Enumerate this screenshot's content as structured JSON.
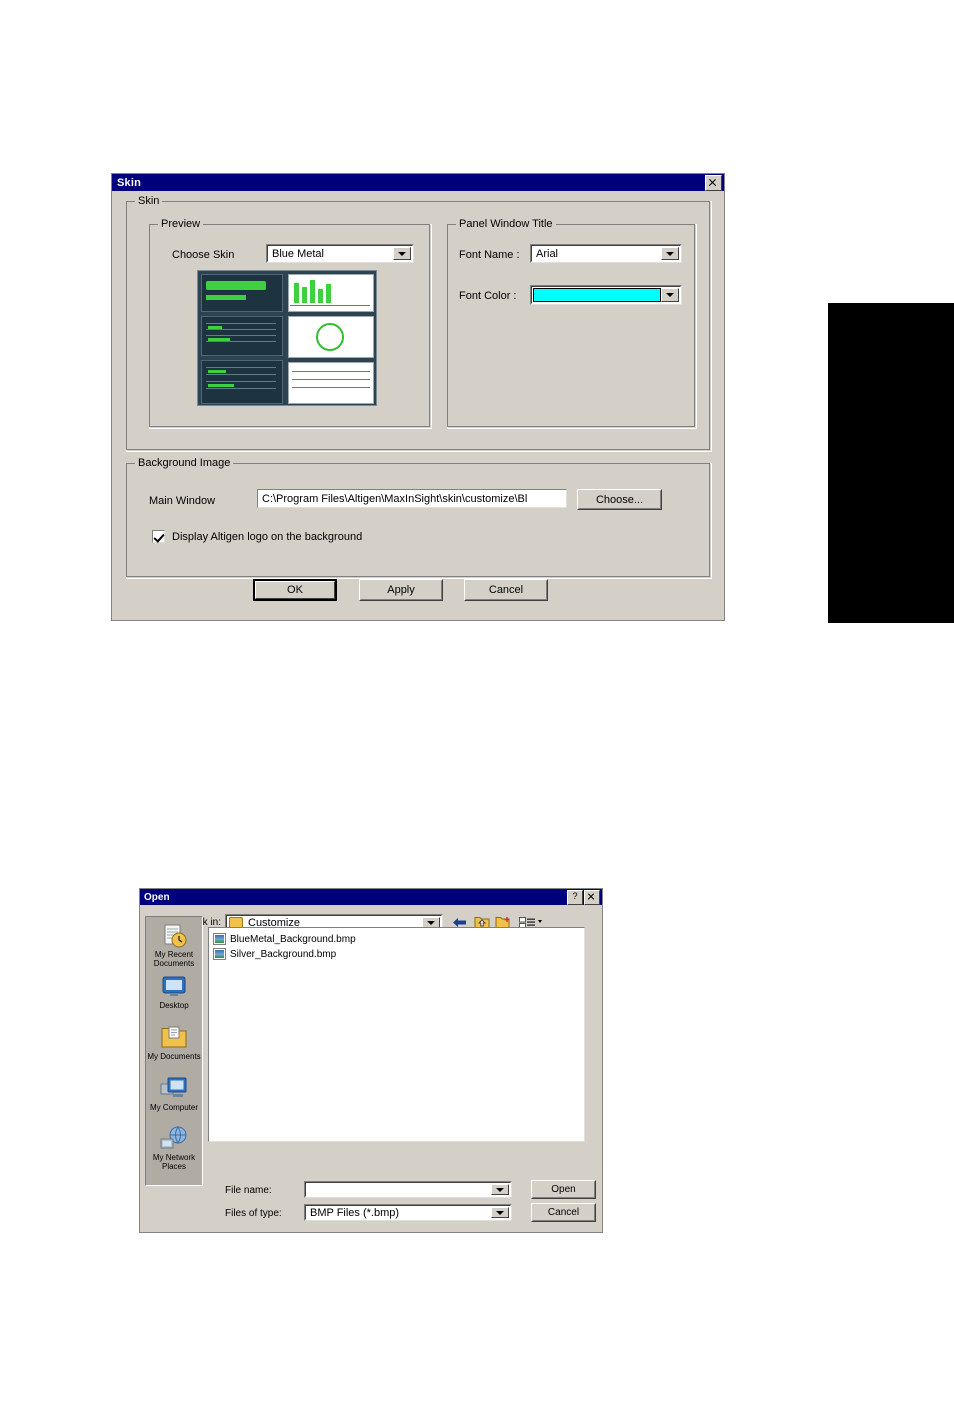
{
  "skin_dialog": {
    "title": "Skin",
    "close_label": "×",
    "groups": {
      "skin": "Skin",
      "preview": "Preview",
      "panel_window_title": "Panel Window Title",
      "background_image": "Background Image"
    },
    "choose_skin_label": "Choose Skin",
    "choose_skin_value": "Blue Metal",
    "font_name_label": "Font Name :",
    "font_name_value": "Arial",
    "font_color_label": "Font Color :",
    "font_color_value": "#00FFFF",
    "main_window_label": "Main Window",
    "main_window_path": "C:\\Program Files\\Altigen\\MaxInSight\\skin\\customize\\Bl",
    "choose_button": "Choose...",
    "display_logo_label": "Display Altigen logo on the background",
    "display_logo_checked": true,
    "ok_button": "OK",
    "apply_button": "Apply",
    "cancel_button": "Cancel"
  },
  "open_dialog": {
    "title": "Open",
    "help_label": "?",
    "close_label": "×",
    "look_in_label": "Look in:",
    "look_in_value": "Customize",
    "sidebar_items": [
      {
        "label": "My Recent Documents",
        "icon": "recent-documents-icon"
      },
      {
        "label": "Desktop",
        "icon": "desktop-icon"
      },
      {
        "label": "My Documents",
        "icon": "my-documents-icon"
      },
      {
        "label": "My Computer",
        "icon": "my-computer-icon"
      },
      {
        "label": "My Network Places",
        "icon": "my-network-places-icon"
      }
    ],
    "files": [
      "BlueMetal_Background.bmp",
      "Silver_Background.bmp"
    ],
    "file_name_label": "File name:",
    "file_name_value": "",
    "files_of_type_label": "Files of type:",
    "files_of_type_value": "BMP Files (*.bmp)",
    "open_button": "Open",
    "cancel_button": "Cancel",
    "toolbar_icons": [
      "back-icon",
      "up-one-level-icon",
      "new-folder-icon",
      "views-icon"
    ]
  }
}
